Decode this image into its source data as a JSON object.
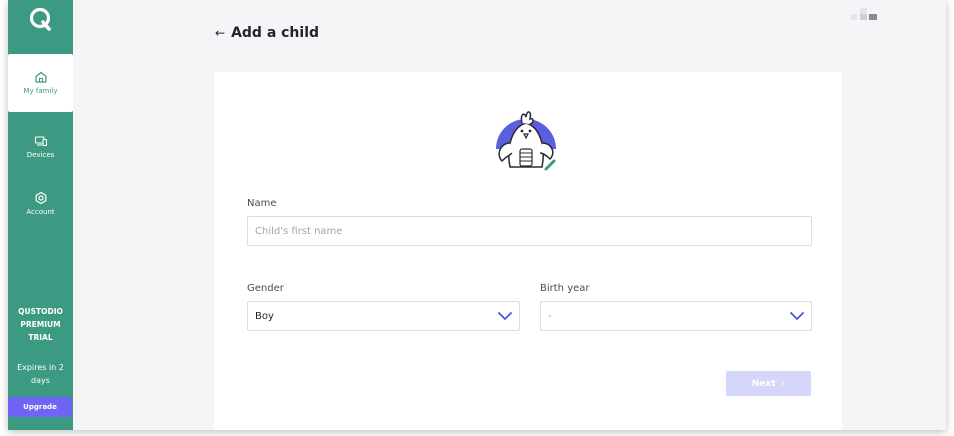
{
  "sidebar": {
    "logo_icon": "qustodio-q-logo",
    "items": [
      {
        "label": "My family",
        "icon": "home-icon",
        "active": true
      },
      {
        "label": "Devices",
        "icon": "devices-icon",
        "active": false
      },
      {
        "label": "Account",
        "icon": "gear-icon",
        "active": false
      }
    ],
    "trial_title": "QUSTODIO PREMIUM TRIAL",
    "expires_text": "Expires in 2 days",
    "upgrade_label": "Upgrade"
  },
  "header": {
    "back_icon": "←",
    "title": "Add a child"
  },
  "form": {
    "avatar_icon": "chicken-avatar",
    "name_label": "Name",
    "name_placeholder": "Child's first name",
    "name_value": "",
    "gender_label": "Gender",
    "gender_value": "Boy",
    "birth_year_label": "Birth year",
    "birth_year_value": "-",
    "next_label": "Next",
    "next_icon": "›"
  },
  "colors": {
    "brand_green": "#3d9a82",
    "accent_purple": "#7064f5",
    "disabled_button": "#d4d7f9",
    "chevron_blue": "#4a58d8"
  }
}
